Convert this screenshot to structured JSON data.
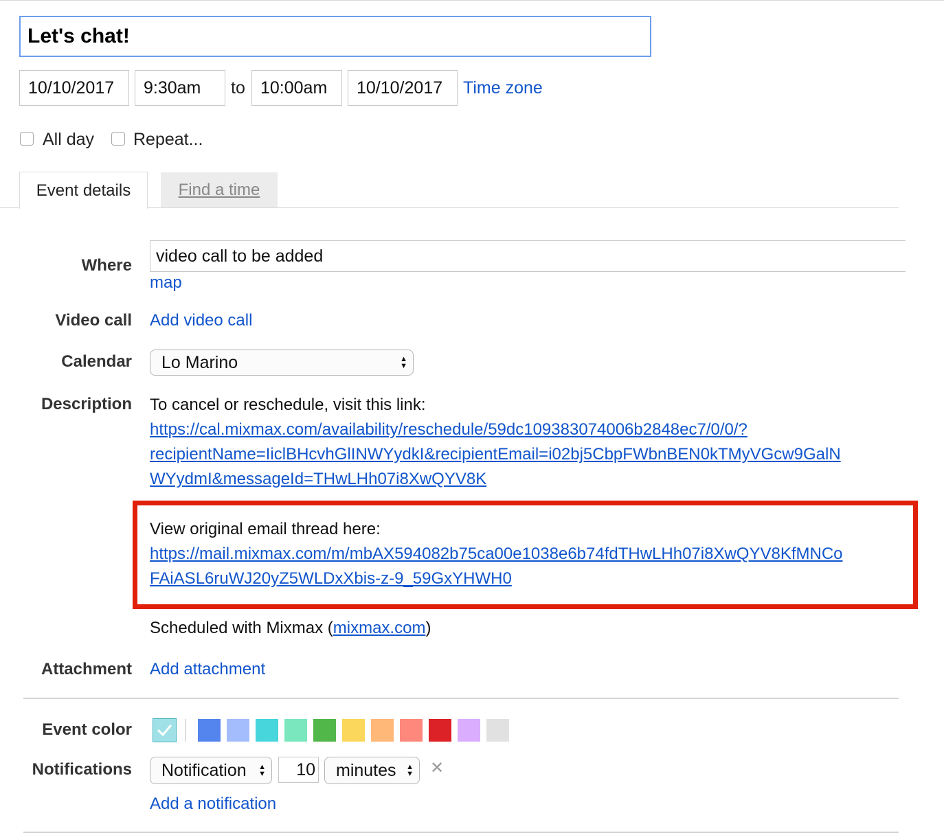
{
  "title": "Let's chat!",
  "when": {
    "start_date": "10/10/2017",
    "start_time": "9:30am",
    "to_label": "to",
    "end_time": "10:00am",
    "end_date": "10/10/2017",
    "timezone_link": "Time zone"
  },
  "options": {
    "all_day": "All day",
    "repeat": "Repeat..."
  },
  "tabs": [
    {
      "label": "Event details"
    },
    {
      "label": "Find a time"
    }
  ],
  "where": {
    "label": "Where",
    "value": "video call to be added",
    "map_link": "map"
  },
  "video_call": {
    "label": "Video call",
    "link": "Add video call"
  },
  "calendar": {
    "label": "Calendar",
    "value": "Lo Marino"
  },
  "description": {
    "label": "Description",
    "line1": "To cancel or reschedule, visit this link:",
    "url1_a": "https://cal.mixmax.com/availability/reschedule/59dc109383074006b2848ec7/0/0/?",
    "url1_b": "recipientName=IiclBHcvhGlINWYydkI&recipientEmail=i02bj5CbpFWbnBEN0kTMyVGcw9GalN",
    "url1_c": "WYydmI&messageId=THwLHh07i8XwQYV8K",
    "line2": "View original email thread here:",
    "url2_a": "https://mail.mixmax.com/m/mbAX594082b75ca00e1038e6b74fdTHwLHh07i8XwQYV8KfMNCo",
    "url2_b": "FAiASL6ruWJ20yZ5WLDxXbis-z-9_59GxYHWH0",
    "sched_prefix": "Scheduled with Mixmax (",
    "sched_link": "mixmax.com",
    "sched_suffix": ")"
  },
  "attachment": {
    "label": "Attachment",
    "link": "Add attachment"
  },
  "event_color": {
    "label": "Event color",
    "selected": "#9fe1e7",
    "colors": [
      "#5484ed",
      "#a4bdfc",
      "#46d6db",
      "#7ae7bf",
      "#51b749",
      "#fbd75b",
      "#ffb878",
      "#ff887c",
      "#dc2127",
      "#dbadff",
      "#e1e1e1"
    ]
  },
  "notifications": {
    "label": "Notifications",
    "type": "Notification",
    "amount": "10",
    "unit": "minutes",
    "remove_icon": "close-icon",
    "add_link": "Add a notification"
  },
  "highlight_color": "#e0200a",
  "link_color": "#1155cc"
}
